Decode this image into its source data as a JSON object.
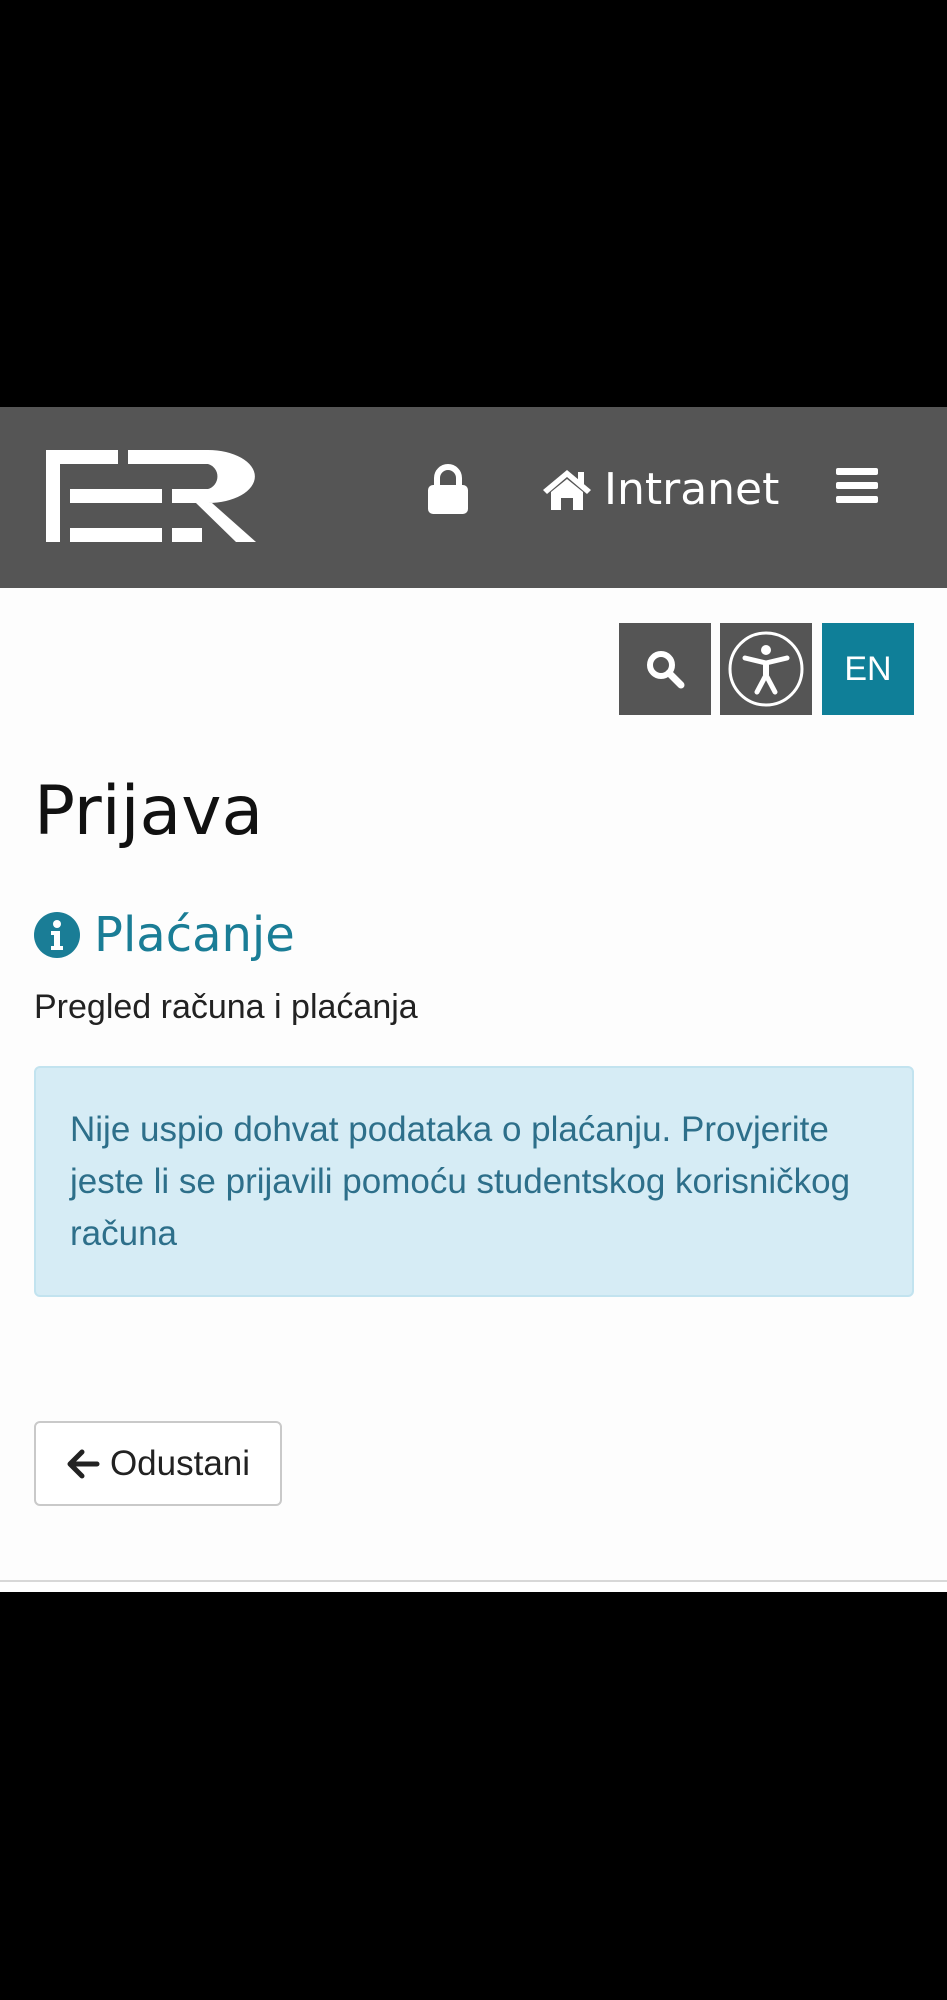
{
  "header": {
    "logo_text": "FER",
    "lock_icon": "lock-icon",
    "intranet_label": "Intranet",
    "home_icon": "home-icon",
    "menu_icon": "hamburger-menu-icon",
    "background_color": "#555555"
  },
  "toolbar": {
    "search_icon": "search-icon",
    "accessibility_icon": "accessibility-icon",
    "language_label": "EN",
    "language_color": "#0f7f98"
  },
  "main": {
    "page_title": "Prijava",
    "section_title": "Plaćanje",
    "section_icon": "info-icon",
    "subtitle": "Pregled računa i plaćanja",
    "alert_text": "Nije uspio dohvat podataka o plaćanju. Provjerite jeste li se prijavili pomoću studentskog korisničkog računa",
    "cancel_label": "Odustani",
    "cancel_icon": "arrow-left-icon",
    "accent_color": "#1a7d96"
  }
}
